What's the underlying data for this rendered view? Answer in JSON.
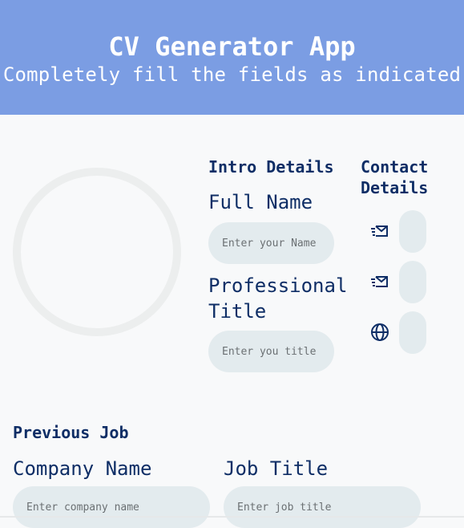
{
  "header": {
    "title": "CV Generator App",
    "subtitle": "Completely fill the fields as indicated"
  },
  "intro": {
    "section_title": "Intro Details",
    "full_name_label": "Full Name",
    "full_name_placeholder": "Enter your Name",
    "professional_title_label": "Professional Title",
    "professional_title_placeholder": "Enter you title"
  },
  "contact": {
    "section_title": "Contact Details",
    "items": [
      {
        "icon": "mail-icon"
      },
      {
        "icon": "mail-icon"
      },
      {
        "icon": "globe-icon"
      }
    ]
  },
  "previous_job": {
    "section_title": "Previous Job",
    "company_name_label": "Company Name",
    "company_name_placeholder": "Enter company name",
    "job_title_label": "Job Title",
    "job_title_placeholder": "Enter job title"
  },
  "colors": {
    "header_bg": "#7b9de3",
    "accent_text": "#0f2e66",
    "input_bg": "#e3ebee"
  }
}
